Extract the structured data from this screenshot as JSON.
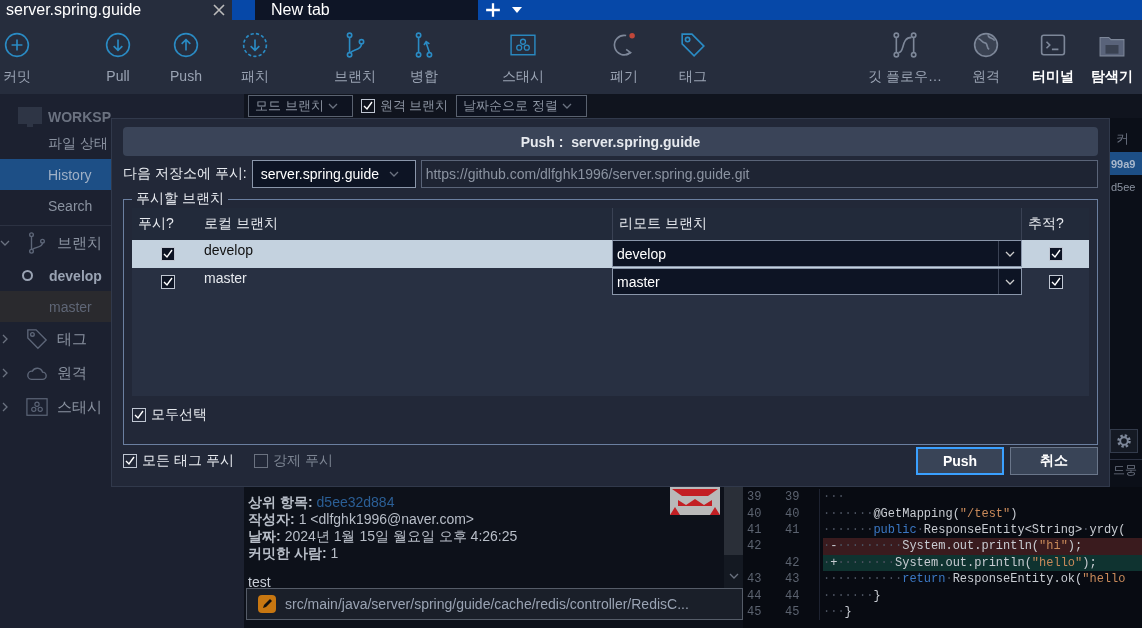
{
  "tabs": [
    {
      "label": "server.spring.guide",
      "selected": true,
      "closable": true
    },
    {
      "label": "New tab",
      "selected": false,
      "closable": false
    }
  ],
  "toolbar": [
    {
      "kind": "commit",
      "label": "커밋",
      "highlighted": false
    },
    {
      "kind": "pull",
      "label": "Pull",
      "highlighted": false
    },
    {
      "kind": "push",
      "label": "Push",
      "highlighted": false
    },
    {
      "kind": "fetch",
      "label": "패치",
      "highlighted": false
    },
    {
      "kind": "branch",
      "label": "브랜치",
      "highlighted": false
    },
    {
      "kind": "merge",
      "label": "병합",
      "highlighted": false
    },
    {
      "kind": "stash",
      "label": "스태시",
      "highlighted": false
    },
    {
      "kind": "discard",
      "label": "폐기",
      "highlighted": false
    },
    {
      "kind": "tag",
      "label": "태그",
      "highlighted": false
    },
    {
      "kind": "gitflow",
      "label": "깃 플로우…",
      "highlighted": false
    },
    {
      "kind": "remote",
      "label": "원격",
      "highlighted": false
    },
    {
      "kind": "terminal",
      "label": "터미널",
      "highlighted": true
    },
    {
      "kind": "explorer",
      "label": "탐색기",
      "highlighted": true
    }
  ],
  "sidebar": {
    "workspace": "WORKSP",
    "views": [
      {
        "label": "파일 상태",
        "selected": false
      },
      {
        "label": "History",
        "selected": true
      },
      {
        "label": "Search",
        "selected": false
      }
    ],
    "sections": [
      {
        "kind": "branch",
        "label": "브랜치",
        "expanded": true,
        "children": [
          {
            "label": "develop",
            "current": true,
            "hovered": false
          },
          {
            "label": "master",
            "current": false,
            "hovered": true
          }
        ]
      },
      {
        "kind": "tag",
        "label": "태그",
        "expanded": false
      },
      {
        "kind": "remote",
        "label": "원격",
        "expanded": false
      },
      {
        "kind": "stash",
        "label": "스태시",
        "expanded": false
      }
    ]
  },
  "filter_bar": {
    "branch_filter": "모드 브랜치",
    "remote_branches": {
      "label": "원격 브랜치",
      "checked": true
    },
    "sort": "날짜순으로 정렬"
  },
  "commit_list": {
    "header": "커",
    "rows": [
      {
        "text": "99a9",
        "selected": true
      },
      {
        "text": "d5ee",
        "selected": false
      }
    ],
    "side_tab": "드뭉"
  },
  "commit_details": {
    "fields": [
      {
        "label": "상위 항목:",
        "value": "d5ee32d884",
        "kind": "link"
      },
      {
        "label": "작성자:",
        "value": "1 <dlfghk1996@naver.com>",
        "kind": "text"
      },
      {
        "label": "날짜:",
        "value": "2024년 1월 15일 월요일 오후 4:26:25",
        "kind": "text"
      },
      {
        "label": "커밋한 사람:",
        "value": "1",
        "kind": "text"
      }
    ],
    "message": "test",
    "file_path": "src/main/java/server/spring/guide/cache/redis/controller/RedisC..."
  },
  "diff": {
    "lines": [
      {
        "old": "39",
        "new": "39",
        "kind": "context",
        "segments": [
          {
            "text": "···",
            "kind": "ws"
          }
        ]
      },
      {
        "old": "40",
        "new": "40",
        "kind": "context",
        "segments": [
          {
            "text": "·······",
            "kind": "ws"
          },
          {
            "text": "@GetMapping(",
            "kind": "plain"
          },
          {
            "text": "\"/test\"",
            "kind": "string"
          },
          {
            "text": ")",
            "kind": "plain"
          }
        ]
      },
      {
        "old": "41",
        "new": "41",
        "kind": "context",
        "segments": [
          {
            "text": "·······",
            "kind": "ws"
          },
          {
            "text": "public",
            "kind": "keyword"
          },
          {
            "text": "·",
            "kind": "ws"
          },
          {
            "text": "ResponseEntity<String>",
            "kind": "plain"
          },
          {
            "text": "·",
            "kind": "ws"
          },
          {
            "text": "yrdy(",
            "kind": "plain"
          }
        ]
      },
      {
        "old": "42",
        "kind": "removed",
        "segments": [
          {
            "text": "·",
            "kind": "ws"
          },
          {
            "text": "-",
            "kind": "plain"
          },
          {
            "text": "·········",
            "kind": "ws"
          },
          {
            "text": "System.out.println(",
            "kind": "plain"
          },
          {
            "text": "\"hi\"",
            "kind": "string"
          },
          {
            "text": ");",
            "kind": "plain"
          }
        ]
      },
      {
        "new": "42",
        "kind": "added",
        "segments": [
          {
            "text": "·",
            "kind": "ws"
          },
          {
            "text": "+",
            "kind": "plain"
          },
          {
            "text": "········",
            "kind": "ws"
          },
          {
            "text": "System.out.println(",
            "kind": "plain"
          },
          {
            "text": "\"hello\"",
            "kind": "string"
          },
          {
            "text": ");",
            "kind": "plain"
          }
        ]
      },
      {
        "old": "43",
        "new": "43",
        "kind": "context",
        "segments": [
          {
            "text": "···········",
            "kind": "ws"
          },
          {
            "text": "return",
            "kind": "keyword"
          },
          {
            "text": "·",
            "kind": "ws"
          },
          {
            "text": "ResponseEntity.ok(",
            "kind": "plain"
          },
          {
            "text": "\"hello",
            "kind": "string"
          }
        ]
      },
      {
        "old": "44",
        "new": "44",
        "kind": "context",
        "segments": [
          {
            "text": "·······",
            "kind": "ws"
          },
          {
            "text": "}",
            "kind": "plain"
          }
        ]
      },
      {
        "old": "45",
        "new": "45",
        "kind": "context",
        "segments": [
          {
            "text": "···",
            "kind": "ws"
          },
          {
            "text": "}",
            "kind": "plain"
          }
        ]
      }
    ]
  },
  "dialog": {
    "title": "Push :  server.spring.guide",
    "remote_label": "다음 저장소에 푸시:",
    "remote": "server.spring.guide",
    "url": "https://github.com/dlfghk1996/server.spring.guide.git",
    "group_label": "푸시할 브랜치",
    "columns": [
      "푸시?",
      "로컬 브랜치",
      "리모트 브랜치",
      "추적?"
    ],
    "rows": [
      {
        "push": true,
        "local": "develop",
        "remote": "develop",
        "track": true,
        "selected": true
      },
      {
        "push": true,
        "local": "master",
        "remote": "master",
        "track": true,
        "selected": false
      }
    ],
    "select_all": {
      "label": "모두선택",
      "checked": true
    },
    "options": [
      {
        "label": "모든 태그 푸시",
        "checked": true,
        "disabled": false
      },
      {
        "label": "강제 푸시",
        "checked": false,
        "disabled": true
      }
    ],
    "buttons": [
      {
        "label": "Push",
        "focused": true
      },
      {
        "label": "취소",
        "focused": false
      }
    ]
  }
}
